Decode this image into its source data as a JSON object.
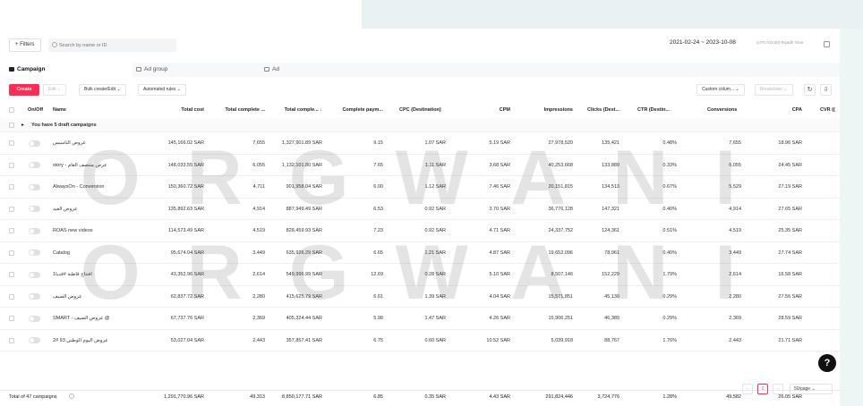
{
  "toolbar": {
    "filters_label": "+ Filters",
    "search_placeholder": "Search by name or ID",
    "date_range": "2021-02-24  ~  2023-10-08",
    "timezone": "(UTC+03:00) Riyadh Time"
  },
  "tabs": [
    {
      "label": "Campaign",
      "active": true
    },
    {
      "label": "Ad group",
      "active": false
    },
    {
      "label": "Ad",
      "active": false
    }
  ],
  "actions": {
    "create": "Create",
    "edit": "Edit  ⌄",
    "bulk": "Bulk create/Edit  ⌄",
    "automated": "Automated rules  ⌄",
    "custom_columns": "Custom colum...  ⌄",
    "breakdown": "Breakdown  ⌄"
  },
  "table": {
    "headers": [
      "On/Off",
      "Name",
      "Total cost",
      "Total complete ...",
      "Total comple... ↓",
      "Complete paym...",
      "CPC (Destination)",
      "CPM",
      "Impressions",
      "Clicks (Dest...",
      "CTR (Destin...",
      "Conversions",
      "CPA",
      "CVR (("
    ],
    "draft_label": "You have 5 draft campaigns",
    "rows": [
      {
        "name": "عروض التأسيس",
        "cost": "145,166.02 SAR",
        "complete": "7,655",
        "value": "1,327,901.89 SAR",
        "rate": "9.15",
        "cpc": "1.07 SAR",
        "cpm": "5.19 SAR",
        "impressions": "27,978,520",
        "clicks": "135,421",
        "ctr": "0.48%",
        "conversions": "7,655",
        "cpa": "18.96 SAR"
      },
      {
        "name": "story - عرض منتصف العام",
        "cost": "148,033.55 SAR",
        "complete": "6,055",
        "value": "1,132,101.80 SAR",
        "rate": "7.65",
        "cpc": "1.11 SAR",
        "cpm": "3.68 SAR",
        "impressions": "40,253,668",
        "clicks": "133,889",
        "ctr": "0.33%",
        "conversions": "6,055",
        "cpa": "24.45 SAR"
      },
      {
        "name": "AlwaysOn - Conversion",
        "cost": "150,360.72 SAR",
        "complete": "4,711",
        "value": "901,958.04 SAR",
        "rate": "6.00",
        "cpc": "1.12 SAR",
        "cpm": "7.46 SAR",
        "impressions": "20,151,815",
        "clicks": "134,513",
        "ctr": "0.67%",
        "conversions": "5,529",
        "cpa": "27.19 SAR"
      },
      {
        "name": "عروض العيد",
        "cost": "135,892.63 SAR",
        "complete": "4,914",
        "value": "887,949.49 SAR",
        "rate": "6.53",
        "cpc": "0.92 SAR",
        "cpm": "3.70 SAR",
        "impressions": "36,776,128",
        "clicks": "147,321",
        "ctr": "0.40%",
        "conversions": "4,914",
        "cpa": "27.65 SAR"
      },
      {
        "name": "ROAS new videos",
        "cost": "114,573.49 SAR",
        "complete": "4,519",
        "value": "828,459.93 SAR",
        "rate": "7.23",
        "cpc": "0.92 SAR",
        "cpm": "4.71 SAR",
        "impressions": "24,337,752",
        "clicks": "124,361",
        "ctr": "0.51%",
        "conversions": "4,519",
        "cpa": "25.35 SAR"
      },
      {
        "name": "Catalog",
        "cost": "95,674.04 SAR",
        "complete": "3,449",
        "value": "635,926.29 SAR",
        "rate": "6.65",
        "cpc": "1.21 SAR",
        "cpm": "4.87 SAR",
        "impressions": "19,652,096",
        "clicks": "78,961",
        "ctr": "0.40%",
        "conversions": "3,449",
        "cpa": "27.74 SAR"
      },
      {
        "name": "افتتاح قاطنة #قديا1",
        "cost": "43,352.96 SAR",
        "complete": "2,614",
        "value": "549,996.99 SAR",
        "rate": "12.69",
        "cpc": "0.28 SAR",
        "cpm": "5.10 SAR",
        "impressions": "8,507,146",
        "clicks": "152,229",
        "ctr": "1.79%",
        "conversions": "2,614",
        "cpa": "16.58 SAR"
      },
      {
        "name": "عروض الصيف",
        "cost": "62,837.72 SAR",
        "complete": "2,280",
        "value": "415,625.79 SAR",
        "rate": "6.61",
        "cpc": "1.39 SAR",
        "cpm": "4.04 SAR",
        "impressions": "15,571,851",
        "clicks": "45,130",
        "ctr": "0.29%",
        "conversions": "2,280",
        "cpa": "27.56 SAR"
      },
      {
        "name": "SMART - عروض الصيف @",
        "cost": "67,737.76 SAR",
        "complete": "2,369",
        "value": "405,324.44 SAR",
        "rate": "5.98",
        "cpc": "1.47 SAR",
        "cpm": "4.26 SAR",
        "impressions": "15,906,251",
        "clicks": "46,389",
        "ctr": "0.29%",
        "conversions": "2,369",
        "cpa": "28.59 SAR"
      },
      {
        "name": "عروض اليوم الوطني 93 #2",
        "cost": "53,027.04 SAR",
        "complete": "2,443",
        "value": "357,857.41 SAR",
        "rate": "6.75",
        "cpc": "0.60 SAR",
        "cpm": "10.52 SAR",
        "impressions": "5,039,918",
        "clicks": "88,767",
        "ctr": "1.76%",
        "conversions": "2,443",
        "cpa": "21.71 SAR"
      }
    ],
    "total": {
      "label": "Total of 47 campaigns",
      "cost": "1,291,770.96 SAR",
      "complete": "49,313",
      "value": "8,850,177.71 SAR",
      "rate": "6.85",
      "cpc": "0.35 SAR",
      "cpm": "4.43 SAR",
      "impressions": "291,824,446",
      "clicks": "3,724,776",
      "ctr": "1.28%",
      "conversions": "49,582",
      "cpa": "26.05 SAR"
    }
  },
  "pagination": {
    "current": "1",
    "per_page": "50/page  ⌄"
  },
  "watermark": {
    "line1": "ORGWANI",
    "line2": "ORGWANI"
  }
}
